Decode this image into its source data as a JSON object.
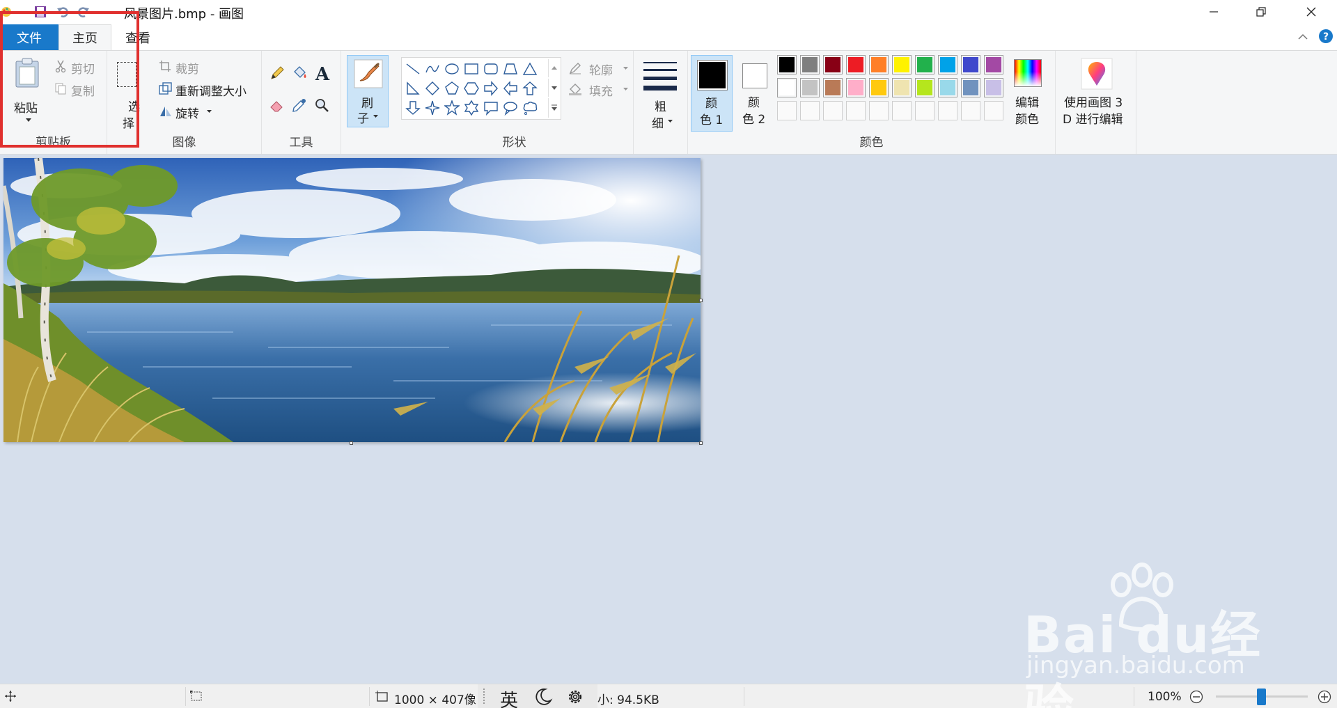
{
  "window": {
    "title": "风景图片.bmp - 画图"
  },
  "tabs": {
    "file": "文件",
    "home": "主页",
    "view": "查看"
  },
  "ribbon": {
    "clipboard": {
      "paste": "粘贴",
      "cut": "剪切",
      "copy": "复制",
      "label": "剪贴板"
    },
    "image": {
      "select_line1": "选",
      "select_line2": "择",
      "crop": "裁剪",
      "resize": "重新调整大小",
      "rotate": "旋转",
      "label": "图像"
    },
    "tools": {
      "label": "工具"
    },
    "brushes": {
      "line1": "刷",
      "line2": "子"
    },
    "shapes": {
      "outline": "轮廓",
      "fill": "填充",
      "label": "形状"
    },
    "size": {
      "line1": "粗",
      "line2": "细"
    },
    "colors": {
      "color1_line1": "颜",
      "color1_line2": "色 1",
      "color2_line1": "颜",
      "color2_line2": "色 2",
      "edit_line1": "编辑",
      "edit_line2": "颜色",
      "label": "颜色",
      "palette_row1": [
        "#000000",
        "#7f7f7f",
        "#880015",
        "#ed1c24",
        "#ff7f27",
        "#fff200",
        "#22b14c",
        "#00a2e8",
        "#3f48cc",
        "#a349a4"
      ],
      "palette_row2": [
        "#ffffff",
        "#c3c3c3",
        "#b97a57",
        "#ffaec9",
        "#ffc90e",
        "#efe4b0",
        "#b5e61d",
        "#99d9ea",
        "#7092be",
        "#c8bfe7"
      ],
      "primary": "#000000",
      "secondary": "#ffffff"
    },
    "paint3d": {
      "line1": "使用画图 3",
      "line2": "D 进行编辑"
    }
  },
  "statusbar": {
    "dimensions": "1000 × 407像",
    "ime_lang": "英",
    "size_fragment": "小: 94.5KB",
    "zoom": "100%"
  },
  "watermark": {
    "brand": "Bai du经验",
    "url": "jingyan.baidu.com"
  }
}
